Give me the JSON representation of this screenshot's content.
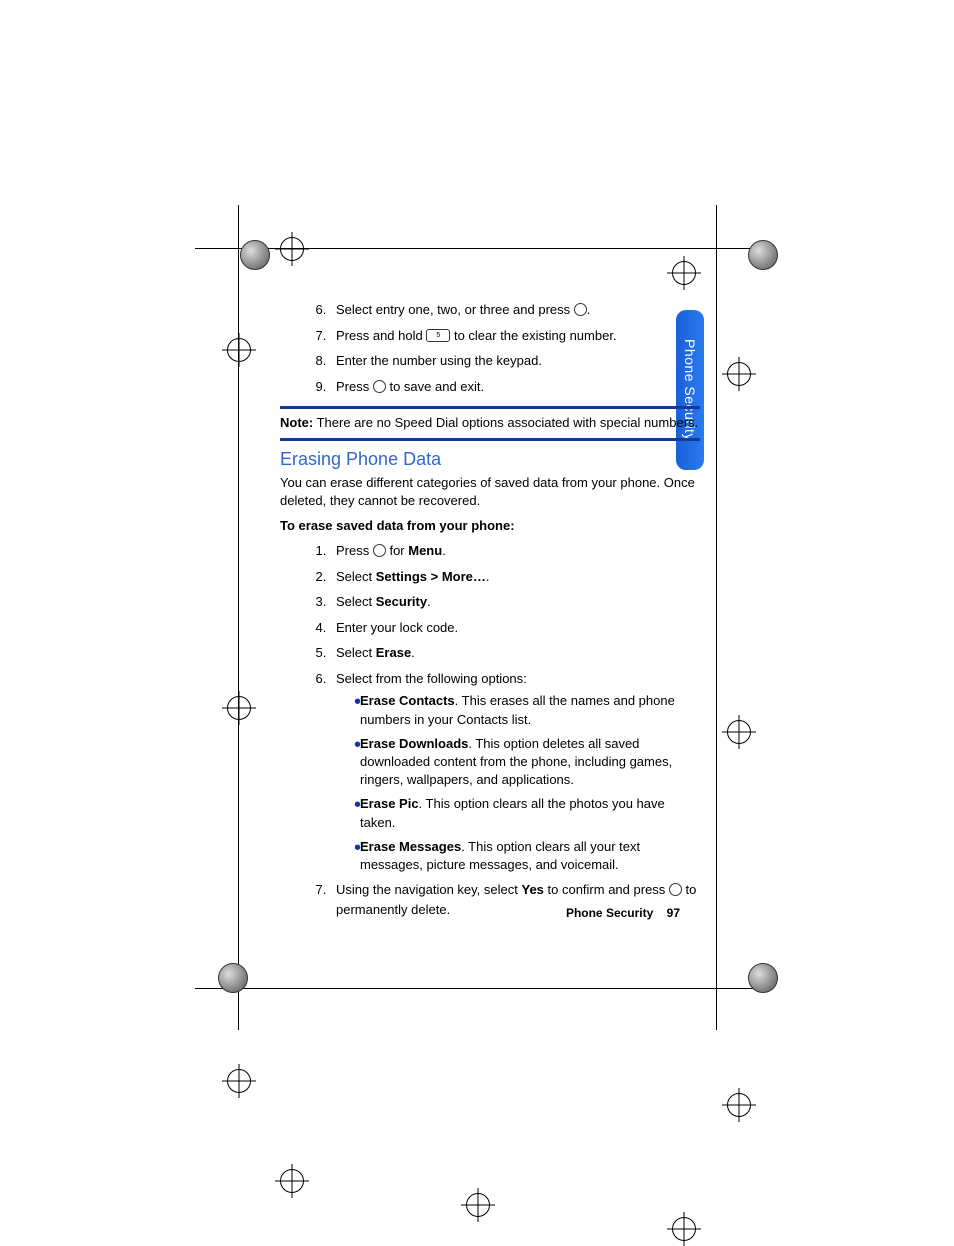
{
  "section_tab": "Phone Security",
  "first_list": {
    "start": 6,
    "items": [
      {
        "pre": "Select entry one, two, or three and press ",
        "post": "."
      },
      {
        "pre": "Press and hold ",
        "key": "5",
        "post": " to clear the existing number."
      },
      {
        "text": "Enter the number using the keypad."
      },
      {
        "pre": "Press ",
        "post": " to save and exit."
      }
    ]
  },
  "note": {
    "label": "Note:",
    "text": " There are no Speed Dial options associated with special numbers."
  },
  "heading": "Erasing Phone Data",
  "intro": "You can erase different categories of saved data from your phone. Once deleted, they cannot be recovered.",
  "subhead": "To erase saved data from your phone:",
  "steps": {
    "s1_pre": "Press ",
    "s1_post": " for ",
    "s1_bold": "Menu",
    "s1_end": ".",
    "s2_pre": "Select ",
    "s2_bold": "Settings > More…",
    "s2_end": ".",
    "s3_pre": "Select ",
    "s3_bold": "Security",
    "s3_end": ".",
    "s4": "Enter your lock code.",
    "s5_pre": "Select ",
    "s5_bold": "Erase",
    "s5_end": ".",
    "s6": "Select from the following options:",
    "bullets": {
      "b1_bold": "Erase Contacts",
      "b1_text": ". This erases all the names and phone numbers in your Contacts list.",
      "b2_bold": "Erase Downloads",
      "b2_text": ". This option deletes all saved downloaded content from the phone, including games, ringers, wallpapers, and applications.",
      "b3_bold": "Erase Pic",
      "b3_text": ". This option clears all the photos you have taken.",
      "b4_bold": "Erase Messages",
      "b4_text": ". This option clears all your text messages, picture messages, and voicemail."
    },
    "s7_pre": "Using the navigation key, select ",
    "s7_bold": "Yes",
    "s7_mid": " to confirm and press ",
    "s7_post": " to permanently delete."
  },
  "footer": {
    "title": "Phone Security",
    "page": "97"
  }
}
